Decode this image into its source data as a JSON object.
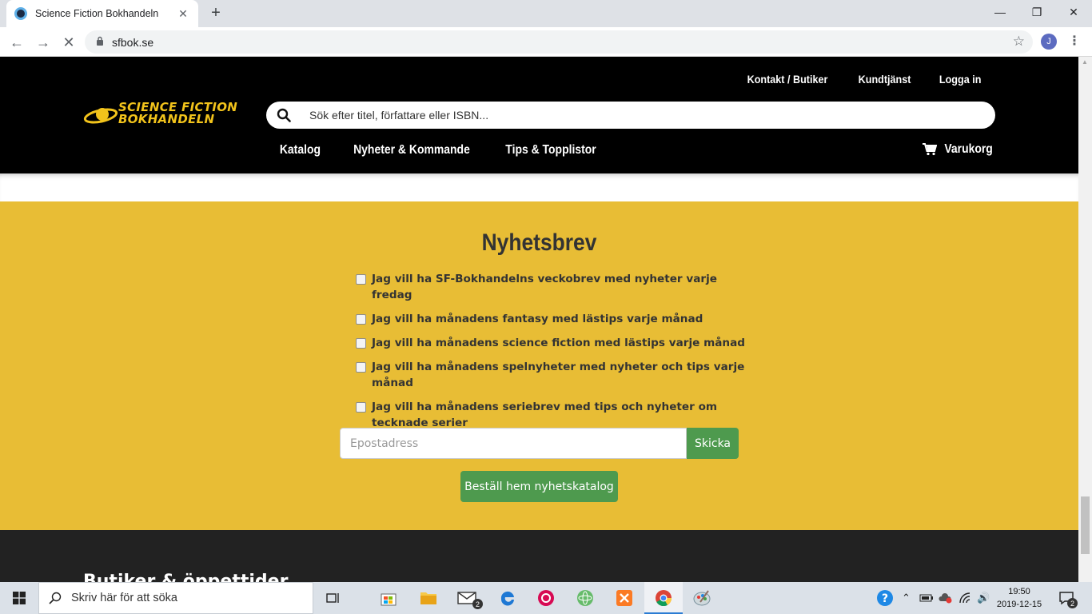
{
  "browser": {
    "tab_title": "Science Fiction Bokhandeln",
    "new_tab": "+",
    "url": "sfbok.se",
    "profile_initial": "J"
  },
  "header": {
    "logo_line1": "SCIENCE FICTION",
    "logo_line2": "BOKHANDELN",
    "logo_color": "#f2c31b",
    "top_links": [
      "Kontakt / Butiker",
      "Kundtjänst",
      "Logga in"
    ],
    "search_placeholder": "Sök efter titel, författare eller ISBN...",
    "nav": [
      "Katalog",
      "Nyheter & Kommande",
      "Tips & Topplistor"
    ],
    "cart_label": "Varukorg"
  },
  "newsletter": {
    "title": "Nyhetsbrev",
    "background": "#e8bd35",
    "options": [
      "Jag vill ha SF-Bokhandelns veckobrev med nyheter varje fredag",
      "Jag vill ha månadens fantasy med lästips varje månad",
      "Jag vill ha månadens science fiction med lästips varje månad",
      "Jag vill ha månadens spelnyheter med nyheter och tips varje månad",
      "Jag vill ha månadens seriebrev med tips och nyheter om tecknade serier"
    ],
    "email_placeholder": "Epostadress",
    "send_label": "Skicka",
    "catalog_button": "Beställ hem nyhetskatalog",
    "button_color": "#4e9a4e"
  },
  "footer": {
    "heading": "Butiker & öppettider"
  },
  "taskbar": {
    "search_placeholder": "Skriv här för att söka",
    "mail_badge": "2",
    "notification_badge": "2",
    "time": "19:50",
    "date": "2019-12-15"
  }
}
